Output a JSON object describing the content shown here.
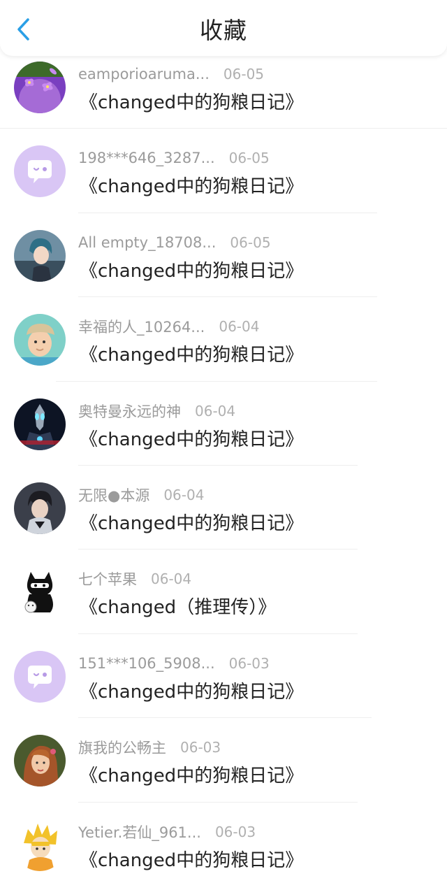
{
  "header": {
    "title": "收藏",
    "back_icon": "chevron-left-icon",
    "accent_color": "#2a9fe6"
  },
  "items": [
    {
      "username": "eamporioaruma...",
      "date": "06-05",
      "book": "《changed中的狗粮日记》",
      "avatar": "purple-flowers-avatar"
    },
    {
      "username": "198***646_3287...",
      "date": "06-05",
      "book": "《changed中的狗粮日记》",
      "avatar": "default-chat-bubble-avatar"
    },
    {
      "username": "All empty_18708...",
      "date": "06-05",
      "book": "《changed中的狗粮日记》",
      "avatar": "anime-character-avatar"
    },
    {
      "username": "幸福的人_10264...",
      "date": "06-04",
      "book": "《changed中的狗粮日记》",
      "avatar": "child-cap-avatar"
    },
    {
      "username": "奥特曼永远的神",
      "date": "06-04",
      "book": "《changed中的狗粮日记》",
      "avatar": "ultraman-avatar"
    },
    {
      "username": "无限●本源",
      "date": "06-04",
      "book": "《changed中的狗粮日记》",
      "avatar": "anime-boy-avatar"
    },
    {
      "username": "七个苹果",
      "date": "06-04",
      "book": "《changed（推理传）》",
      "avatar": "black-cat-cartoon-avatar"
    },
    {
      "username": "151***106_5908...",
      "date": "06-03",
      "book": "《changed中的狗粮日记》",
      "avatar": "default-chat-bubble-avatar"
    },
    {
      "username": "旗我的公畅主",
      "date": "06-03",
      "book": "《changed中的狗粮日记》",
      "avatar": "portrait-woman-avatar"
    },
    {
      "username": "Yetier.若仙_961...",
      "date": "06-03",
      "book": "《changed中的狗粮日记》",
      "avatar": "yellow-hair-anime-avatar"
    }
  ]
}
